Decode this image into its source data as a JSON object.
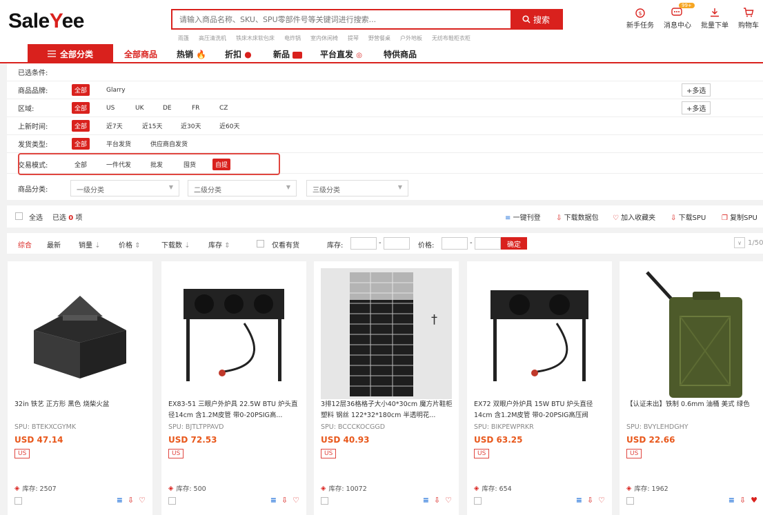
{
  "header": {
    "logo_a": "Sale",
    "logo_b": "Y",
    "logo_c": "ee",
    "search_placeholder": "请输入商品名称、SKU、SPU零部件号等关键词进行搜索...",
    "search_button": "搜索",
    "hot_words": [
      "雨篷",
      "高压清洗机",
      "铁床木床软包床",
      "电炸锅",
      "室内休闲椅",
      "提琴",
      "野营餐桌",
      "户外地板",
      "无纺布鞋柜衣柜"
    ],
    "tools": [
      {
        "label": "新手任务",
        "icon": "money-bag-icon"
      },
      {
        "label": "消息中心",
        "icon": "message-icon",
        "badge": "99+"
      },
      {
        "label": "批量下单",
        "icon": "download-icon"
      },
      {
        "label": "购物车",
        "icon": "cart-icon"
      }
    ]
  },
  "nav": {
    "all_categories": "全部分类",
    "items": [
      "全部商品",
      "热销",
      "折扣",
      "新品",
      "平台直发",
      "特供商品"
    ]
  },
  "filters": {
    "selected_label": "已选条件:",
    "brand": {
      "label": "商品品牌:",
      "options": [
        "全部",
        "Glarry"
      ],
      "multi": "+多选"
    },
    "region": {
      "label": "区域:",
      "options": [
        "全部",
        "US",
        "UK",
        "DE",
        "FR",
        "CZ"
      ],
      "multi": "+多选"
    },
    "new_time": {
      "label": "上新时间:",
      "options": [
        "全部",
        "近7天",
        "近15天",
        "近30天",
        "近60天"
      ]
    },
    "ship_type": {
      "label": "发货类型:",
      "options": [
        "全部",
        "平台发货",
        "供应商自发货"
      ]
    },
    "trade_mode": {
      "label": "交易模式:",
      "options": [
        "全部",
        "一件代发",
        "批发",
        "囤货",
        "自提"
      ]
    },
    "category": {
      "label": "商品分类:",
      "level1": "一级分类",
      "level2": "二级分类",
      "level3": "三级分类"
    }
  },
  "bulk": {
    "select_all": "全选",
    "selected_prefix": "已选",
    "selected_count": "0",
    "selected_suffix": "项",
    "actions": [
      "一键刊登",
      "下载数据包",
      "加入收藏夹",
      "下载SPU",
      "复制SPU"
    ]
  },
  "sort": {
    "items": [
      "综合",
      "最新",
      "销量",
      "价格",
      "下载数",
      "库存"
    ],
    "in_stock": "仅看有货",
    "stock_label": "库存:",
    "price_label": "价格:",
    "dash": "-",
    "confirm": "确定",
    "page": "1/50"
  },
  "products": [
    {
      "title": "32in 铁艺 正方形 黑色 烧柴火盆",
      "spu": "SPU: BTEKXCGYMK",
      "price": "USD 47.14",
      "country": "US",
      "stock": "库存: 2507",
      "fav": false
    },
    {
      "title": "EX83-51 三眼户外炉具 22.5W BTU 炉头直径14cm 含1.2M皮管 带0-20PSIG高...",
      "spu": "SPU: BJTLTPPAVD",
      "price": "USD 72.53",
      "country": "US",
      "stock": "库存: 500",
      "fav": false
    },
    {
      "title": "3排12层36格格子大小40*30cm 魔方片鞋柜 塑料 钢丝 122*32*180cm 半透明花...",
      "spu": "SPU: BCCCKOCGGD",
      "price": "USD 40.93",
      "country": "US",
      "stock": "库存: 10072",
      "fav": false
    },
    {
      "title": "EX72 双眼户外炉具 15W BTU 炉头直径14cm 含1.2M皮管 带0-20PSIG高压阀",
      "spu": "SPU: BIKPEWPRKR",
      "price": "USD 63.25",
      "country": "US",
      "stock": "库存: 654",
      "fav": false
    },
    {
      "title": "【认证未出】铁制 0.6mm 油桶 美式 绿色",
      "spu": "SPU: BVYLEHDGHY",
      "price": "USD 22.66",
      "country": "US",
      "stock": "库存: 1962",
      "fav": true
    }
  ]
}
